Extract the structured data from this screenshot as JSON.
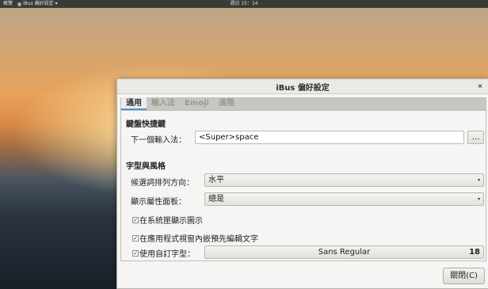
{
  "topbar": {
    "activities": "概覽",
    "app_name": "iBus 偏好設定",
    "app_arrow": "▾",
    "clock": "週日 15：14"
  },
  "window": {
    "title": "iBus 偏好設定",
    "close_glyph": "×"
  },
  "tabs": [
    {
      "label": "通用",
      "active": true
    },
    {
      "label": "輸入法",
      "active": false
    },
    {
      "label": "Emoji",
      "active": false
    },
    {
      "label": "進階",
      "active": false
    }
  ],
  "keyboard": {
    "heading": "鍵盤快捷鍵",
    "next_ime_label": "下一個輸入法：",
    "next_ime_value": "<Super>space",
    "more_button": "..."
  },
  "font_style": {
    "heading": "字型與風格",
    "orientation_label": "候選詞排列方向：",
    "orientation_value": "水平",
    "panel_label": "顯示屬性面板：",
    "panel_value": "總是",
    "combo_arrow": "▾",
    "show_tray_label": "在系統匣顯示圖示",
    "show_tray_checked": true,
    "embed_preedit_label": "在應用程式視窗內嵌預先編輯文字",
    "embed_preedit_checked": true,
    "custom_font_label": "使用自訂字型：",
    "custom_font_checked": true,
    "font_name": "Sans Regular",
    "font_size": "18",
    "check_glyph": "✓"
  },
  "footer": {
    "close_button": "關閉(C)"
  },
  "colors": {
    "accent": "#4a90d9",
    "topbar_bg": "#3b3a36",
    "window_bg": "#f6f5f4"
  }
}
